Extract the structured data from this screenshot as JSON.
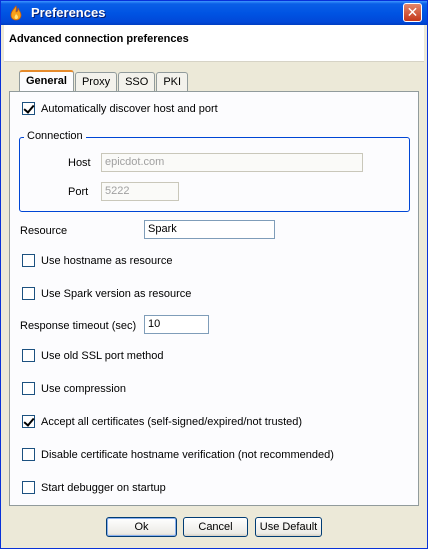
{
  "window": {
    "title": "Preferences"
  },
  "header": {
    "title": "Advanced connection preferences"
  },
  "tabs": [
    "General",
    "Proxy",
    "SSO",
    "PKI"
  ],
  "general": {
    "auto_discover": {
      "label": "Automatically discover host and port",
      "checked": true
    },
    "connection": {
      "group_label": "Connection",
      "host_label": "Host",
      "host_value": "epicdot.com",
      "port_label": "Port",
      "port_value": "5222"
    },
    "resource": {
      "label": "Resource",
      "value": "Spark"
    },
    "use_hostname": {
      "label": "Use hostname as resource",
      "checked": false
    },
    "use_spark_version": {
      "label": "Use Spark version as resource",
      "checked": false
    },
    "response_timeout": {
      "label": "Response timeout (sec)",
      "value": "10"
    },
    "old_ssl": {
      "label": "Use old SSL port method",
      "checked": false
    },
    "compression": {
      "label": "Use compression",
      "checked": false
    },
    "accept_certs": {
      "label": "Accept all certificates (self-signed/expired/not trusted)",
      "checked": true
    },
    "disable_hostname_verify": {
      "label": "Disable certificate hostname verification (not recommended)",
      "checked": false
    },
    "debugger": {
      "label": "Start debugger on startup",
      "checked": false
    }
  },
  "buttons": {
    "ok": "Ok",
    "cancel": "Cancel",
    "default": "Use Default"
  }
}
